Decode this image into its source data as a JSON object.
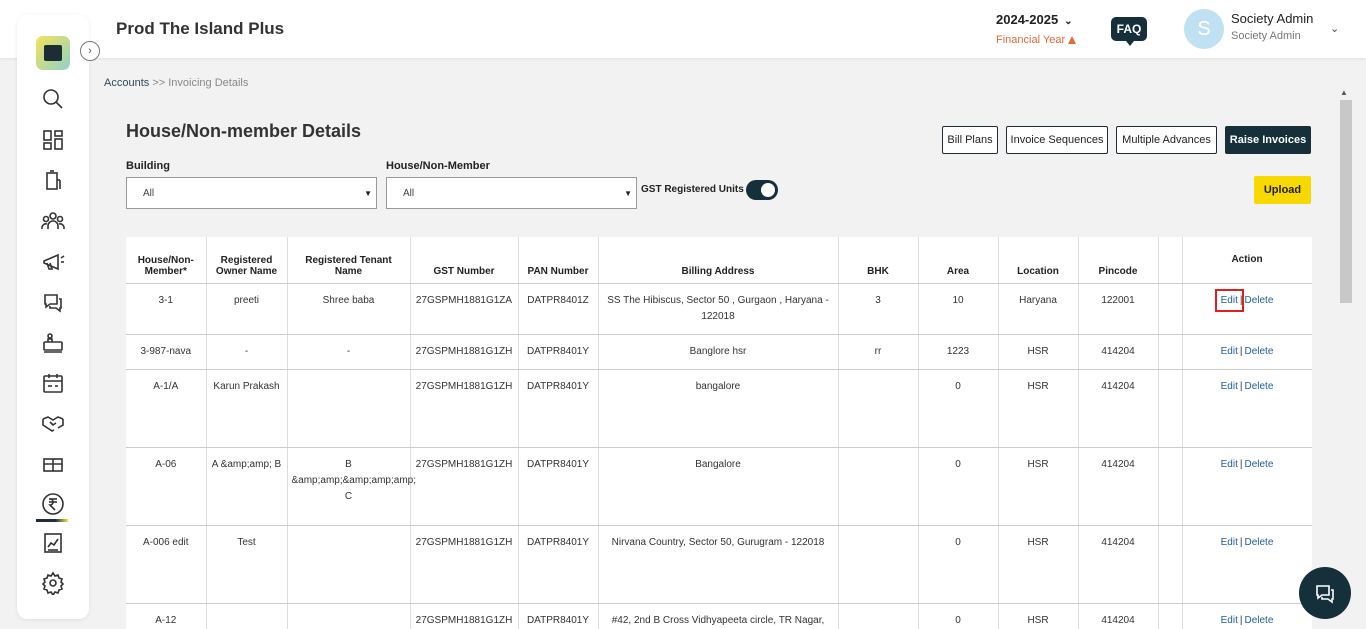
{
  "header": {
    "title": "Prod The Island Plus",
    "year": "2024-2025",
    "year_label": "Financial Year",
    "faq": "FAQ",
    "avatar_letter": "S",
    "user_name": "Society Admin",
    "user_role": "Society Admin"
  },
  "sidebar": {
    "icons": [
      "search-icon",
      "dashboard-icon",
      "building-icon",
      "members-icon",
      "announcement-icon",
      "chat-icon",
      "amenities-icon",
      "calendar-icon",
      "handshake-icon",
      "parcel-icon",
      "rupee-icon",
      "reports-icon",
      "settings-icon"
    ],
    "active": "rupee-icon"
  },
  "breadcrumb": {
    "link": "Accounts",
    "sep": ">>",
    "current": "Invoicing Details"
  },
  "page": {
    "title": "House/Non-member Details",
    "buttons": {
      "bill_plans": "Bill Plans",
      "invoice_sequences": "Invoice Sequences",
      "multiple_advances": "Multiple Advances",
      "raise_invoices": "Raise Invoices",
      "upload": "Upload"
    },
    "filters": {
      "building_label": "Building",
      "building_value": "All",
      "house_label": "House/Non-Member",
      "house_value": "All",
      "gst_toggle_label": "GST Registered Units",
      "gst_toggle_on": true
    }
  },
  "table": {
    "columns": [
      "House/Non-Member*",
      "Registered Owner Name",
      "Registered Tenant Name",
      "GST Number",
      "PAN Number",
      "Billing Address",
      "BHK",
      "Area",
      "Location",
      "Pincode",
      "",
      "Action"
    ],
    "edit_label": "Edit",
    "delete_label": "Delete",
    "rows": [
      {
        "house": "3-1",
        "owner": "preeti",
        "tenant": "Shree baba",
        "gst": "27GSPMH1881G1ZA",
        "pan": "DATPR8401Z",
        "address": "SS The Hibiscus, Sector 50 , Gurgaon , Haryana - 122018",
        "bhk": "3",
        "area": "10",
        "location": "Haryana",
        "pincode": "122001"
      },
      {
        "house": "3-987-nava",
        "owner": "-",
        "tenant": "-",
        "gst": "27GSPMH1881G1ZH",
        "pan": "DATPR8401Y",
        "address": "Banglore hsr",
        "bhk": "rr",
        "area": "1223",
        "location": "HSR",
        "pincode": "414204"
      },
      {
        "house": "A-1/A",
        "owner": "Karun Prakash",
        "tenant": "",
        "gst": "27GSPMH1881G1ZH",
        "pan": "DATPR8401Y",
        "address": "bangalore",
        "bhk": "",
        "area": "0",
        "location": "HSR",
        "pincode": "414204"
      },
      {
        "house": "A-06",
        "owner": "A &amp;amp; B",
        "tenant": "B &amp;amp;&amp;amp;amp; C",
        "gst": "27GSPMH1881G1ZH",
        "pan": "DATPR8401Y",
        "address": "Bangalore",
        "bhk": "",
        "area": "0",
        "location": "HSR",
        "pincode": "414204"
      },
      {
        "house": "A-006 edit",
        "owner": "Test",
        "tenant": "",
        "gst": "27GSPMH1881G1ZH",
        "pan": "DATPR8401Y",
        "address": "Nirvana Country, Sector 50, Gurugram - 122018",
        "bhk": "",
        "area": "0",
        "location": "HSR",
        "pincode": "414204"
      },
      {
        "house": "A-12",
        "owner": "",
        "tenant": "",
        "gst": "27GSPMH1881G1ZH",
        "pan": "DATPR8401Y",
        "address": "#42, 2nd B Cross Vidhyapeeta circle, TR Nagar,",
        "bhk": "",
        "area": "0",
        "location": "HSR",
        "pincode": "414204"
      }
    ]
  }
}
